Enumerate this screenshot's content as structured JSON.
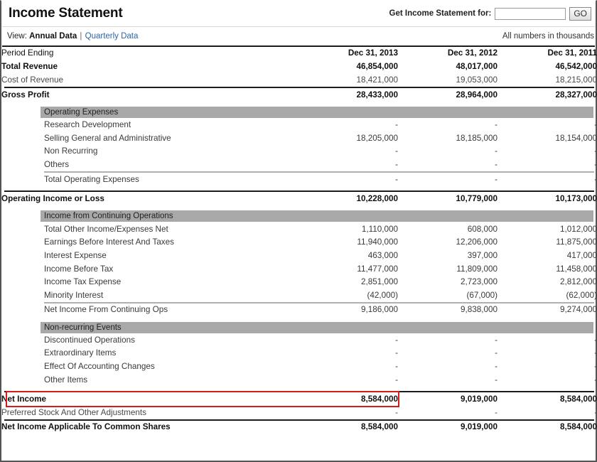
{
  "header": {
    "title": "Income Statement",
    "get_label": "Get Income Statement for:",
    "ticker_value": "",
    "ticker_placeholder": "",
    "go_label": "GO"
  },
  "viewbar": {
    "view_label": "View:",
    "annual_label": "Annual Data",
    "separator": "|",
    "quarterly_label": "Quarterly Data",
    "units_note": "All numbers in thousands"
  },
  "table": {
    "period_label": "Period Ending",
    "columns": [
      "Dec 31, 2013",
      "Dec 31, 2012",
      "Dec 31, 2011"
    ],
    "rows": [
      {
        "kind": "row",
        "style": "bold",
        "label": "Total Revenue",
        "values": [
          "46,854,000",
          "48,017,000",
          "46,542,000"
        ]
      },
      {
        "kind": "row",
        "style": "muted",
        "label": "Cost of Revenue",
        "values": [
          "18,421,000",
          "19,053,000",
          "18,215,000"
        ]
      },
      {
        "kind": "rule-black"
      },
      {
        "kind": "row",
        "style": "bold",
        "label": "Gross Profit",
        "values": [
          "28,433,000",
          "28,964,000",
          "28,327,000"
        ]
      },
      {
        "kind": "spacer-sm"
      },
      {
        "kind": "section",
        "label": "Operating Expenses"
      },
      {
        "kind": "row",
        "style": "indent",
        "label": "Research Development",
        "values": [
          "-",
          "-",
          "-"
        ]
      },
      {
        "kind": "row",
        "style": "indent",
        "label": "Selling General and Administrative",
        "values": [
          "18,205,000",
          "18,185,000",
          "18,154,000"
        ]
      },
      {
        "kind": "row",
        "style": "indent",
        "label": "Non Recurring",
        "values": [
          "-",
          "-",
          "-"
        ]
      },
      {
        "kind": "row",
        "style": "indent",
        "label": "Others",
        "values": [
          "-",
          "-",
          "-"
        ]
      },
      {
        "kind": "rule-grey"
      },
      {
        "kind": "row",
        "style": "indent",
        "label": "Total Operating Expenses",
        "values": [
          "-",
          "-",
          "-"
        ]
      },
      {
        "kind": "spacer-sm"
      },
      {
        "kind": "rule-black"
      },
      {
        "kind": "row",
        "style": "bold",
        "label": "Operating Income or Loss",
        "values": [
          "10,228,000",
          "10,779,000",
          "10,173,000"
        ]
      },
      {
        "kind": "spacer-sm"
      },
      {
        "kind": "section",
        "label": "Income from Continuing Operations"
      },
      {
        "kind": "row",
        "style": "indent",
        "label": "Total Other Income/Expenses Net",
        "values": [
          "1,110,000",
          "608,000",
          "1,012,000"
        ]
      },
      {
        "kind": "row",
        "style": "indent",
        "label": "Earnings Before Interest And Taxes",
        "values": [
          "11,940,000",
          "12,206,000",
          "11,875,000"
        ]
      },
      {
        "kind": "row",
        "style": "indent",
        "label": "Interest Expense",
        "values": [
          "463,000",
          "397,000",
          "417,000"
        ]
      },
      {
        "kind": "row",
        "style": "indent",
        "label": "Income Before Tax",
        "values": [
          "11,477,000",
          "11,809,000",
          "11,458,000"
        ]
      },
      {
        "kind": "row",
        "style": "indent",
        "label": "Income Tax Expense",
        "values": [
          "2,851,000",
          "2,723,000",
          "2,812,000"
        ]
      },
      {
        "kind": "row",
        "style": "indent",
        "label": "Minority Interest",
        "values": [
          "(42,000)",
          "(67,000)",
          "(62,000)"
        ]
      },
      {
        "kind": "rule-grey"
      },
      {
        "kind": "row",
        "style": "indent",
        "label": "Net Income From Continuing Ops",
        "values": [
          "9,186,000",
          "9,838,000",
          "9,274,000"
        ]
      },
      {
        "kind": "spacer-sm"
      },
      {
        "kind": "section",
        "label": "Non-recurring Events"
      },
      {
        "kind": "row",
        "style": "indent",
        "label": "Discontinued Operations",
        "values": [
          "-",
          "-",
          "-"
        ]
      },
      {
        "kind": "row",
        "style": "indent",
        "label": "Extraordinary Items",
        "values": [
          "-",
          "-",
          "-"
        ]
      },
      {
        "kind": "row",
        "style": "indent",
        "label": "Effect Of Accounting Changes",
        "values": [
          "-",
          "-",
          "-"
        ]
      },
      {
        "kind": "row",
        "style": "indent",
        "label": "Other Items",
        "values": [
          "-",
          "-",
          "-"
        ]
      },
      {
        "kind": "spacer-sm"
      },
      {
        "kind": "rule-black"
      },
      {
        "kind": "row",
        "style": "bold",
        "label": "Net Income",
        "values": [
          "8,584,000",
          "9,019,000",
          "8,584,000"
        ],
        "highlight": true
      },
      {
        "kind": "row",
        "style": "muted",
        "label": "Preferred Stock And Other Adjustments",
        "values": [
          "-",
          "-",
          "-"
        ]
      },
      {
        "kind": "rule-black"
      },
      {
        "kind": "row",
        "style": "bold",
        "label": "Net Income Applicable To Common Shares",
        "values": [
          "8,584,000",
          "9,019,000",
          "8,584,000"
        ]
      }
    ]
  },
  "highlight": {
    "color": "#d61b1b"
  }
}
